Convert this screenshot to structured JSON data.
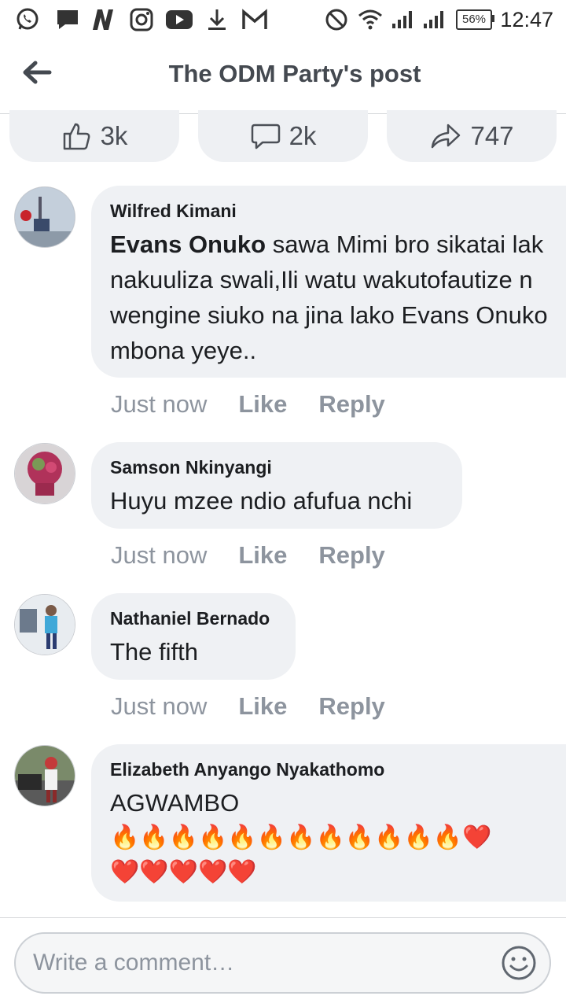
{
  "status_bar": {
    "icons": [
      "whatsapp-icon",
      "message-icon",
      "n-app-icon",
      "instagram-icon",
      "youtube-icon",
      "download-icon",
      "gmail-icon",
      "do-not-disturb-icon",
      "wifi-icon",
      "signal-icon",
      "signal-icon"
    ],
    "battery": "56%",
    "time": "12:47"
  },
  "header": {
    "title": "The ODM Party's post"
  },
  "actions": {
    "likes": "3k",
    "comments": "2k",
    "shares": "747"
  },
  "comments": [
    {
      "author": "Wilfred Kimani",
      "mention": "Evans Onuko",
      "lines": [
        " sawa Mimi bro sikatai lak",
        "nakuuliza swali,Ili watu wakutofautize n",
        "wengine siuko na jina lako Evans Onuko",
        "mbona yeye.."
      ],
      "time": "Just now",
      "like": "Like",
      "reply": "Reply"
    },
    {
      "author": "Samson Nkinyangi",
      "text": "Huyu mzee ndio afufua nchi",
      "time": "Just now",
      "like": "Like",
      "reply": "Reply"
    },
    {
      "author": "Nathaniel Bernado",
      "text": "The fifth",
      "time": "Just now",
      "like": "Like",
      "reply": "Reply"
    },
    {
      "author": "Elizabeth Anyango Nyakathomo",
      "text": "AGWAMBO",
      "emoji_line1": "🔥🔥🔥🔥🔥🔥🔥🔥🔥🔥🔥🔥❤️",
      "emoji_line2": "❤️❤️❤️❤️❤️"
    }
  ],
  "composer": {
    "placeholder": "Write a comment…"
  },
  "colors": {
    "bubble": "#eff1f4",
    "meta": "#8d949e",
    "title": "#444950"
  }
}
